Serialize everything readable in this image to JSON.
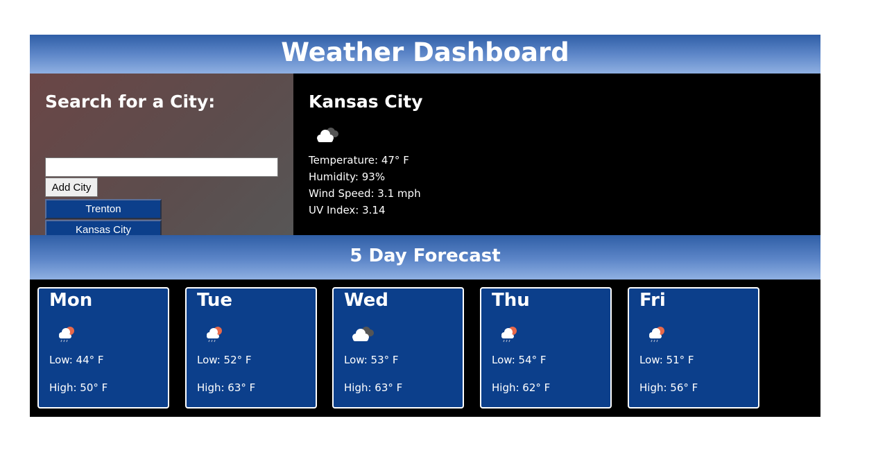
{
  "header": {
    "title": "Weather Dashboard"
  },
  "search": {
    "title": "Search for a City:",
    "input_value": "",
    "placeholder": "",
    "add_label": "Add City",
    "saved_cities": [
      "Trenton",
      "Kansas City"
    ]
  },
  "current": {
    "city": "Kansas City",
    "icon": "cloudy-icon",
    "temperature": "Temperature: 47° F",
    "humidity": "Humidity: 93%",
    "wind": "Wind Speed: 3.1 mph",
    "uv": "UV Index: 3.14"
  },
  "forecast": {
    "title": "5 Day Forecast",
    "days": [
      {
        "day": "Mon",
        "icon": "rain-sun-icon",
        "low": "Low: 44° F",
        "high": "High: 50° F"
      },
      {
        "day": "Tue",
        "icon": "rain-sun-icon",
        "low": "Low: 52° F",
        "high": "High: 63° F"
      },
      {
        "day": "Wed",
        "icon": "cloudy-icon",
        "low": "Low: 53° F",
        "high": "High: 63° F"
      },
      {
        "day": "Thu",
        "icon": "rain-sun-icon",
        "low": "Low: 54° F",
        "high": "High: 62° F"
      },
      {
        "day": "Fri",
        "icon": "rain-sun-icon",
        "low": "Low: 51° F",
        "high": "High: 56° F"
      }
    ]
  },
  "colors": {
    "header_gradient_top": "#2f5ea6",
    "header_gradient_bottom": "#8fb0e2",
    "card_bg": "#0c3f8b",
    "city_button_bg": "#0c3f8b"
  }
}
